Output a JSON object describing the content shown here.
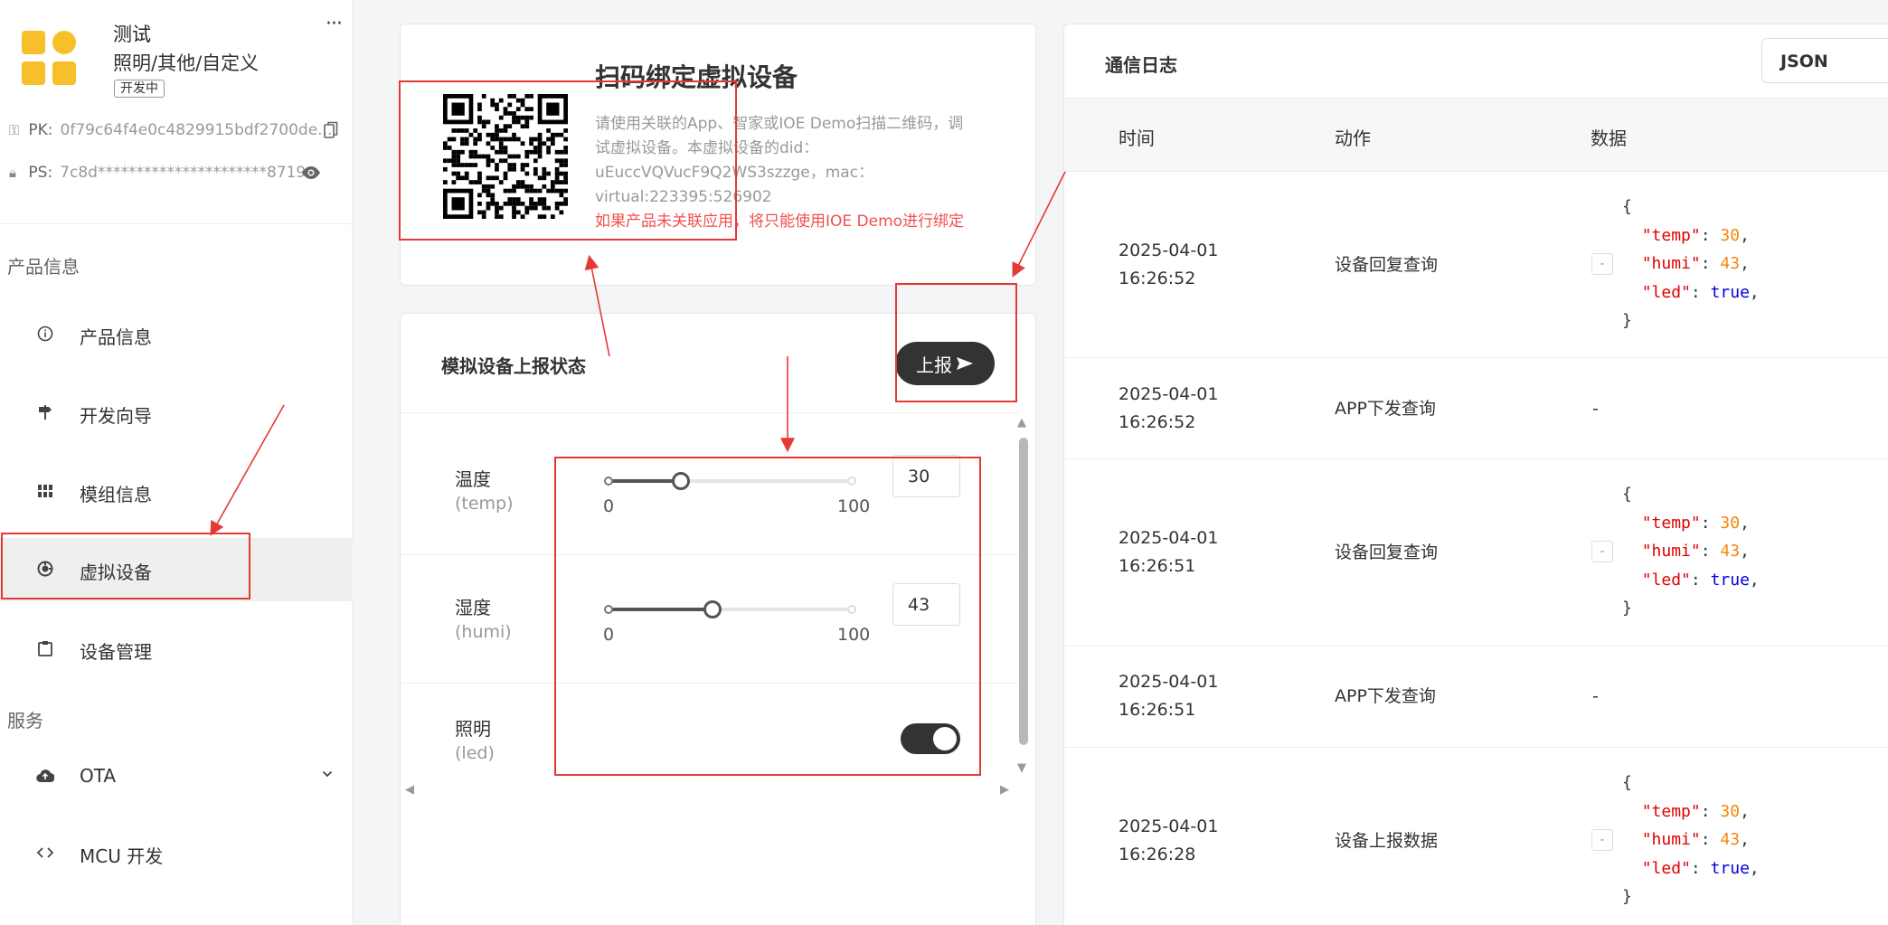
{
  "product": {
    "name": "测试",
    "category": "照明/其他/自定义",
    "status_badge": "开发中",
    "more": "···",
    "pk_label": "PK:",
    "pk_value": "0f79c64f4e0c4829915bdf2700de...",
    "ps_label": "PS:",
    "ps_value": "7c8d**********************8719"
  },
  "sidebar": {
    "section_product": "产品信息",
    "items": [
      {
        "label": "产品信息",
        "icon": "info-icon"
      },
      {
        "label": "开发向导",
        "icon": "signpost-icon"
      },
      {
        "label": "模组信息",
        "icon": "grid-icon"
      },
      {
        "label": "虚拟设备",
        "icon": "virtual-device-icon"
      },
      {
        "label": "设备管理",
        "icon": "clipboard-icon"
      }
    ],
    "section_services": "服务",
    "service_items": [
      {
        "label": "OTA",
        "icon": "cloud-upload-icon"
      },
      {
        "label": "MCU 开发",
        "icon": "code-icon"
      }
    ]
  },
  "qr_panel": {
    "title": "扫码绑定虚拟设备",
    "description": "请使用关联的App、智家或IOE Demo扫描二维码，调试虚拟设备。本虚拟设备的did：uEuccVQVucF9Q2WS3szzge，mac：virtual:223395:526902",
    "warning": "如果产品未关联应用，将只能使用IOE Demo进行绑定"
  },
  "simulator": {
    "title": "模拟设备上报状态",
    "report_button": "上报",
    "fields": [
      {
        "name": "温度",
        "id": "(temp)",
        "value": "30",
        "min": "0",
        "max": "100",
        "fraction": 0.3
      },
      {
        "name": "湿度",
        "id": "(humi)",
        "value": "43",
        "min": "0",
        "max": "100",
        "fraction": 0.43
      },
      {
        "name": "照明",
        "id": "(led)",
        "on": true
      }
    ]
  },
  "log": {
    "title": "通信日志",
    "format": "JSON",
    "columns": {
      "time": "时间",
      "action": "动作",
      "data": "数据"
    },
    "rows": [
      {
        "date": "2025-04-01",
        "time": "16:26:52",
        "action": "设备回复查询",
        "data": "json"
      },
      {
        "date": "2025-04-01",
        "time": "16:26:52",
        "action": "APP下发查询",
        "data": "-"
      },
      {
        "date": "2025-04-01",
        "time": "16:26:51",
        "action": "设备回复查询",
        "data": "json"
      },
      {
        "date": "2025-04-01",
        "time": "16:26:51",
        "action": "APP下发查询",
        "data": "-"
      },
      {
        "date": "2025-04-01",
        "time": "16:26:28",
        "action": "设备上报数据",
        "data": "json"
      }
    ],
    "json_payload": {
      "open": "{",
      "close": "}",
      "temp_key": "\"temp\"",
      "temp_val": "30",
      "humi_key": "\"humi\"",
      "humi_val": "43",
      "led_key": "\"led\"",
      "led_val": "true"
    },
    "collapse_symbol": "-"
  }
}
